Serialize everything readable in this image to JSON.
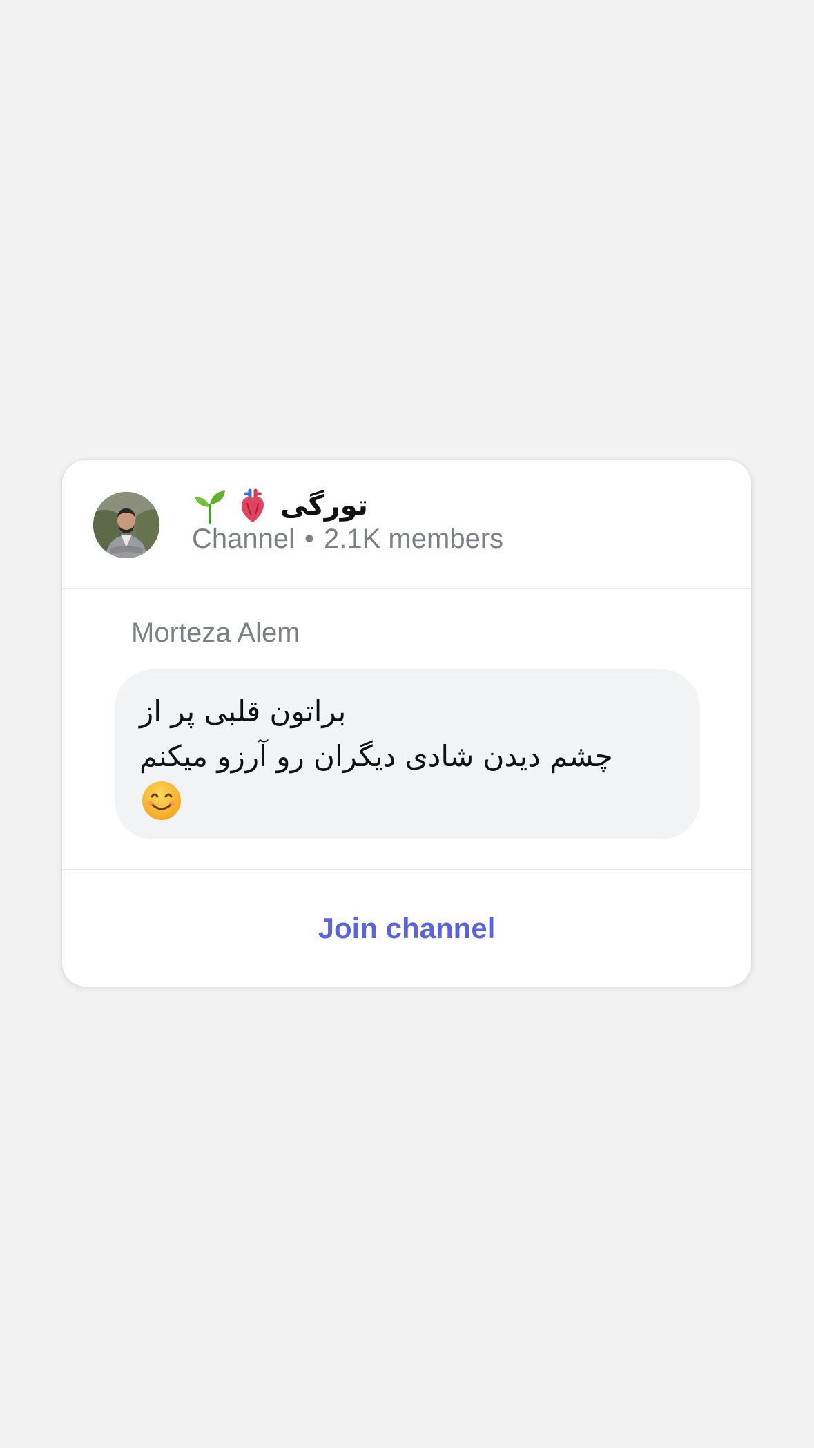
{
  "channel": {
    "title": "تورگی",
    "title_icons": [
      "seedling-icon",
      "anatomical-heart-icon"
    ],
    "type_label": "Channel",
    "separator": "•",
    "members": "2.1K members",
    "avatar": "avatar-photo"
  },
  "message": {
    "sender": "Morteza Alem",
    "line1": "براتون قلبی پر از",
    "line2": "چشم دیدن شادی دیگران رو آرزو میکنم",
    "emoji": "smiling-face-icon"
  },
  "footer": {
    "join_label": "Join channel"
  },
  "colors": {
    "background": "#f2f2f3",
    "card": "#ffffff",
    "bubble": "#f2f3f5",
    "accent": "#5b63dd",
    "muted_text": "#7c7f86"
  }
}
